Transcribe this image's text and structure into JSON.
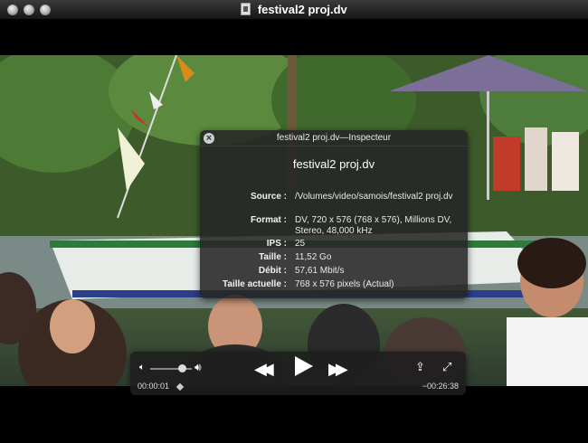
{
  "window": {
    "title": "festival2  proj.dv"
  },
  "inspector": {
    "title": "festival2  proj.dv—Inspecteur",
    "filename": "festival2  proj.dv",
    "rows": [
      {
        "label": "Source :",
        "value": "/Volumes/video/samois/festival2 proj.dv"
      },
      {
        "label": "Format :",
        "value": "DV, 720 x 576 (768 x 576), Millions DV, Stereo, 48,000 kHz"
      },
      {
        "label": "IPS :",
        "value": "25"
      },
      {
        "label": "Taille :",
        "value": "11,52 Go"
      },
      {
        "label": "Débit :",
        "value": "57,61 Mbit/s"
      },
      {
        "label": "Taille actuelle :",
        "value": "768 x 576 pixels (Actual)"
      }
    ]
  },
  "controller": {
    "time_elapsed": "00:00:01",
    "time_remaining": "−00:26:38",
    "volume_level": 0.75,
    "icons": {
      "volume_low": "volume-low-icon",
      "volume_high": "volume-high-icon",
      "rewind": "rewind-icon",
      "play": "play-icon",
      "fast_forward": "fast-forward-icon",
      "share": "share-icon",
      "fullscreen": "fullscreen-icon"
    }
  },
  "colors": {
    "hud_bg": "#262626",
    "titlebar": "#2a2a2a"
  }
}
